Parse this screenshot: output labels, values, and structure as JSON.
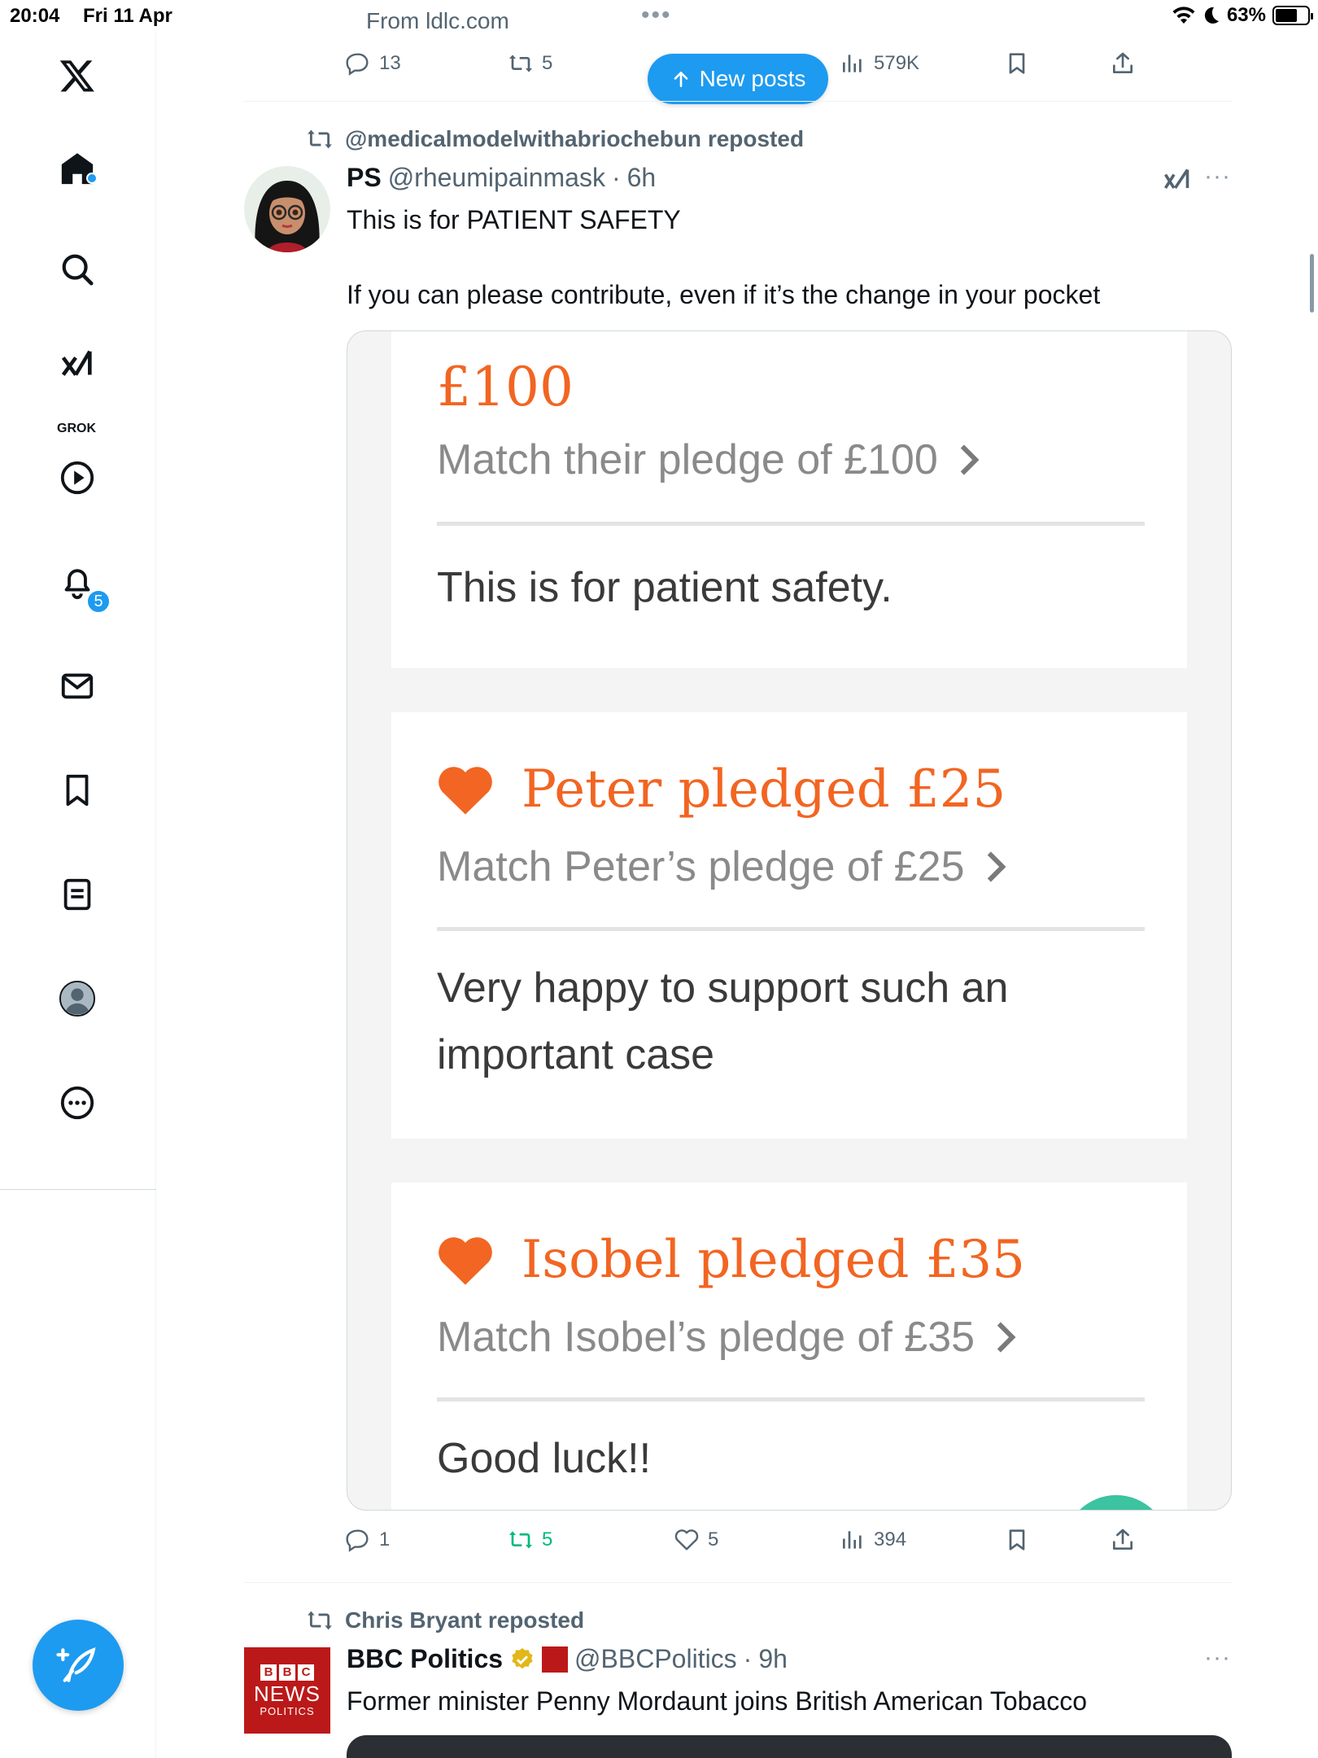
{
  "status_bar": {
    "time": "20:04",
    "date": "Fri 11 Apr",
    "battery": "63%",
    "battery_level": 0.63
  },
  "browser": {
    "from_link": "From ldlc.com",
    "dots": "•••"
  },
  "sidebar": {
    "items": [
      {
        "icon": "x-logo-icon"
      },
      {
        "icon": "home-icon"
      },
      {
        "icon": "search-icon"
      },
      {
        "icon": "grok-icon",
        "label": "GROK"
      },
      {
        "icon": "video-play-icon"
      },
      {
        "icon": "notifications-bell-icon",
        "badge": "5"
      },
      {
        "icon": "messages-envelope-icon"
      },
      {
        "icon": "bookmarks-icon"
      },
      {
        "icon": "lists-icon"
      },
      {
        "icon": "profile-avatar-icon"
      },
      {
        "icon": "more-circle-icon"
      }
    ],
    "compose_icon": "compose-feather-icon"
  },
  "top_post_actions": {
    "replies": "13",
    "reposts": "5",
    "views": "579K"
  },
  "new_posts_button": {
    "label": "New posts",
    "icon": "arrow-up-icon"
  },
  "post1": {
    "repost_line": "@medicalmodelwithabriochebun reposted",
    "author_name": "PS",
    "handle": "@rheumipainmask",
    "separator": "·",
    "time": "6h",
    "text_line1": "This is for PATIENT SAFETY",
    "text_line2": "If you can please contribute, even if it’s the change in your pocket",
    "more": "···",
    "media": {
      "card1": {
        "amount": "£100",
        "match": "Match their pledge of £100",
        "message": "This is for patient safety."
      },
      "card2": {
        "title": "Peter pledged £25",
        "match": "Match Peter’s pledge of £25",
        "message": "Very happy to support such an important case"
      },
      "card3": {
        "title": "Isobel pledged £35",
        "match": "Match Isobel’s pledge of £35",
        "message": "Good luck!!"
      }
    },
    "actions": {
      "replies": "1",
      "reposts": "5",
      "likes": "5",
      "views": "394"
    }
  },
  "post2": {
    "repost_line": "Chris Bryant reposted",
    "author_name": "BBC Politics",
    "handle": "@BBCPolitics",
    "separator": "·",
    "time": "9h",
    "text": "Former minister Penny Mordaunt joins British American Tobacco",
    "more": "···",
    "logo_text": {
      "blocks": [
        "B",
        "B",
        "C"
      ],
      "news": "NEWS",
      "section": "POLITICS"
    }
  },
  "colors": {
    "accent_blue": "#1d9bf0",
    "repost_green": "#00ba7c",
    "pledge_orange": "#f26522",
    "bbc_red": "#bb1919"
  }
}
